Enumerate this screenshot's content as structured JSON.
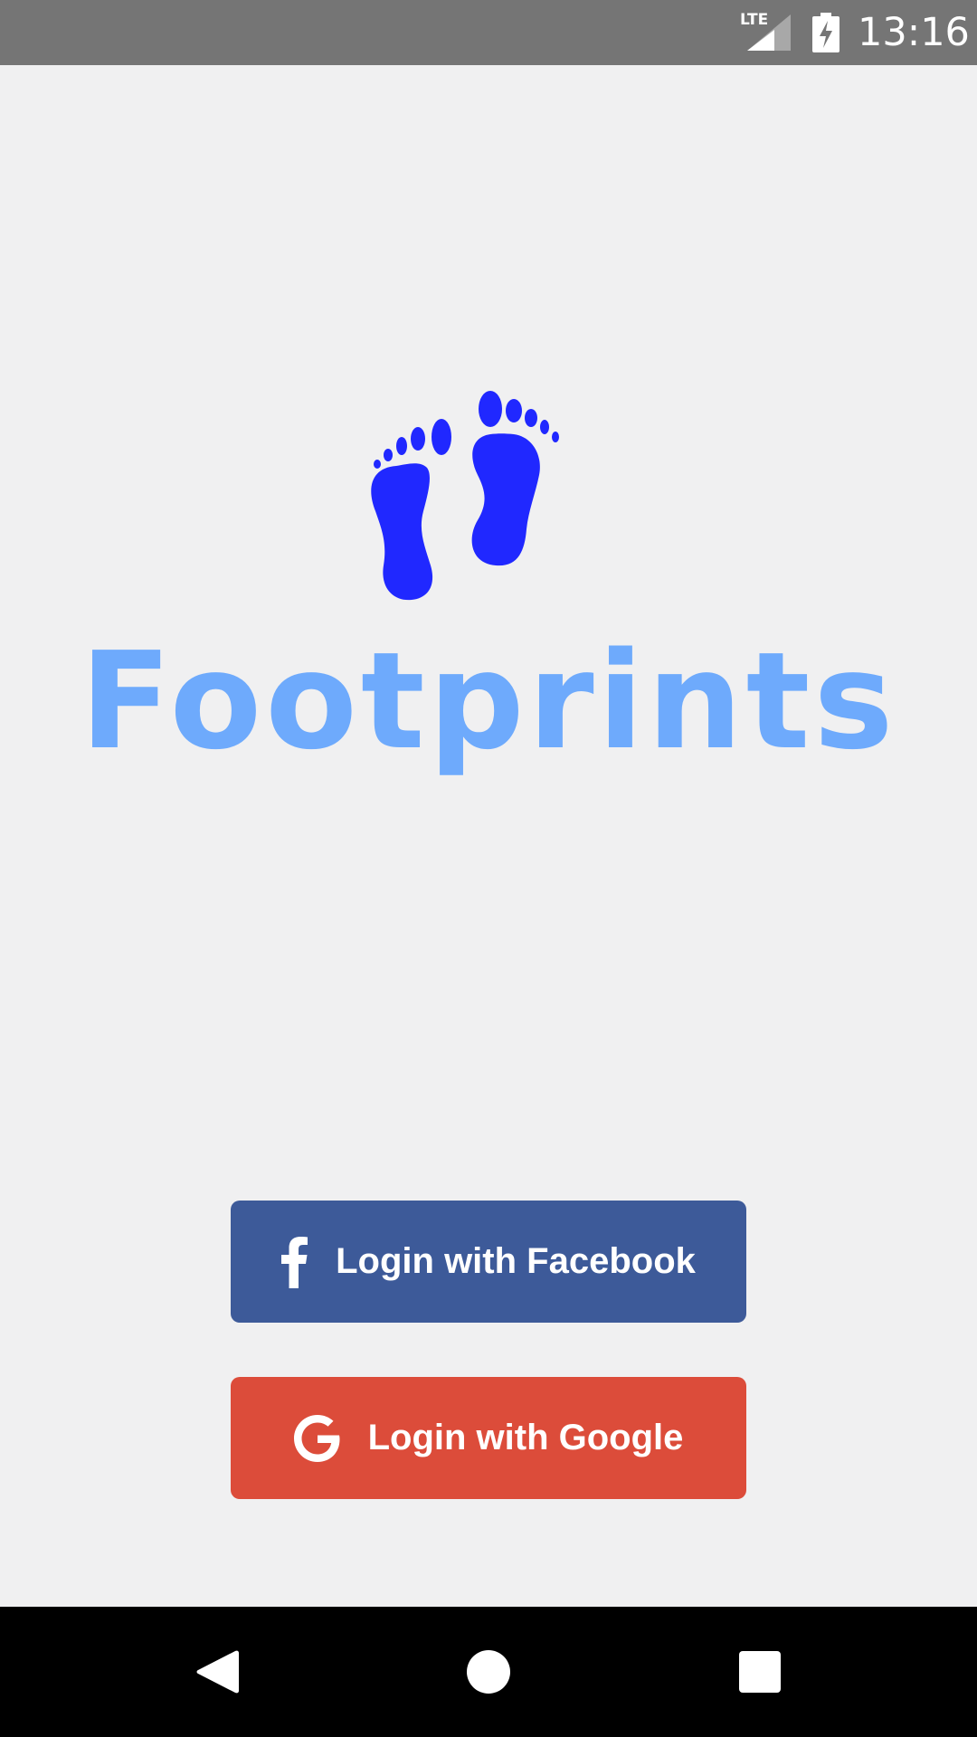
{
  "status_bar": {
    "network_label": "LTE",
    "time": "13:16",
    "icons": [
      "lte-signal-icon",
      "battery-charging-icon"
    ]
  },
  "logo": {
    "icon": "footprints-icon",
    "title": "Footprints",
    "feet_color": "#2028ff",
    "title_color": "#6eaafc"
  },
  "buttons": {
    "facebook": {
      "label": "Login with Facebook",
      "icon": "facebook-icon",
      "color": "#3d5a99"
    },
    "google": {
      "label": "Login with Google",
      "icon": "google-icon",
      "color": "#dc4c3a"
    }
  },
  "nav_bar": {
    "items": [
      "back-icon",
      "home-icon",
      "recents-icon"
    ]
  }
}
